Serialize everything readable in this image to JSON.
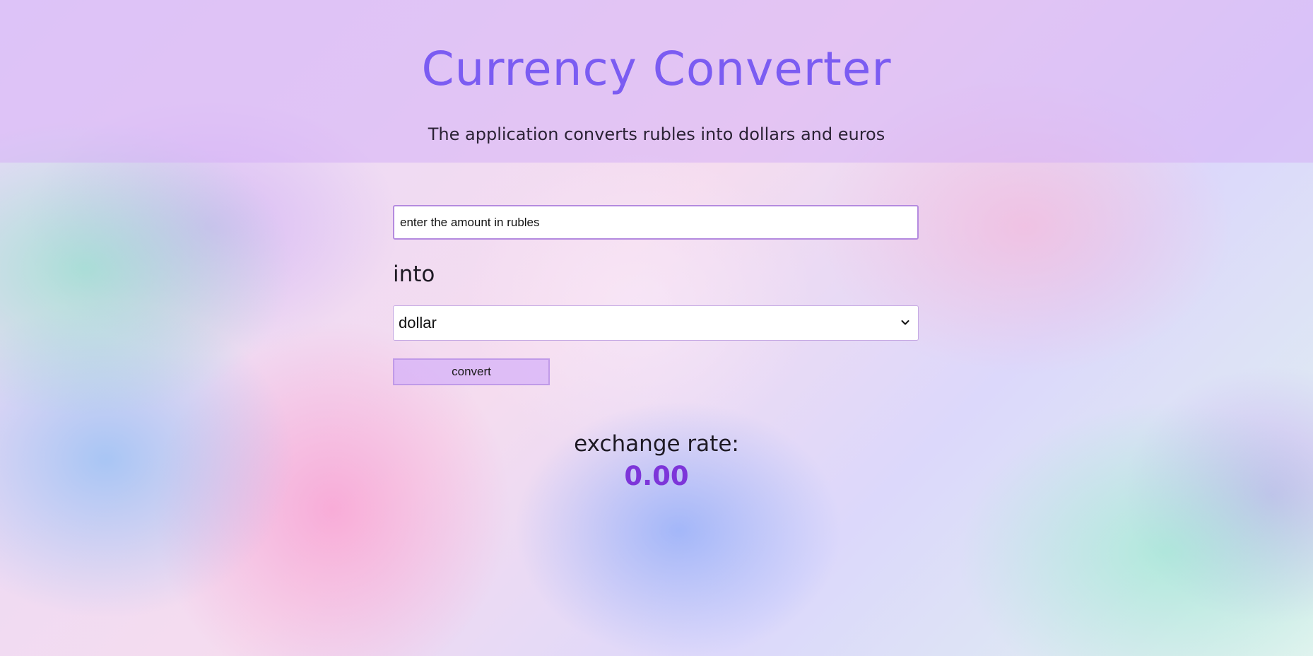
{
  "header": {
    "title": "Currency Converter",
    "subtitle": "The application converts rubles into dollars and euros"
  },
  "form": {
    "amount_placeholder": "enter the amount in rubles",
    "amount_value": "",
    "into_label": "into",
    "currency_selected": "dollar",
    "convert_label": "convert"
  },
  "result": {
    "label": "exchange rate:",
    "value": "0.00"
  },
  "colors": {
    "title": "#7b5cf2",
    "rate_value": "#7d35d9",
    "header_band": "#d6b0f6"
  },
  "icons": {
    "select": "chevron-down-icon"
  }
}
